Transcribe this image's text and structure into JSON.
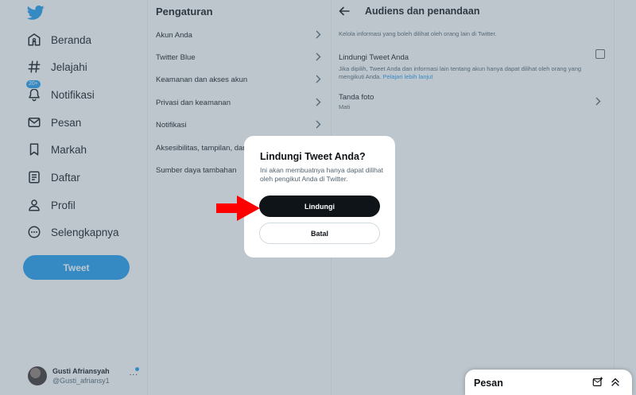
{
  "colors": {
    "accent": "#1d9bf0",
    "text": "#0f1419",
    "muted": "#536471",
    "annotation_arrow": "#ff0000"
  },
  "sidebar": {
    "logo_icon": "twitter-bird-icon",
    "items": [
      {
        "label": "Beranda",
        "icon": "home-icon"
      },
      {
        "label": "Jelajahi",
        "icon": "hashtag-icon"
      },
      {
        "label": "Notifikasi",
        "icon": "bell-icon",
        "badge": "20+"
      },
      {
        "label": "Pesan",
        "icon": "envelope-icon"
      },
      {
        "label": "Markah",
        "icon": "bookmark-icon"
      },
      {
        "label": "Daftar",
        "icon": "list-icon"
      },
      {
        "label": "Profil",
        "icon": "person-icon"
      },
      {
        "label": "Selengkapnya",
        "icon": "more-circle-icon"
      }
    ],
    "tweet_button": "Tweet",
    "account": {
      "name": "Gusti Afriansyah",
      "handle": "@Gusti_afriansy1",
      "more": "..."
    }
  },
  "settings": {
    "title": "Pengaturan",
    "items": [
      {
        "label": "Akun Anda",
        "chevron": true
      },
      {
        "label": "Twitter Blue",
        "chevron": true
      },
      {
        "label": "Keamanan dan akses akun",
        "chevron": true
      },
      {
        "label": "Privasi dan keamanan",
        "chevron": true
      },
      {
        "label": "Notifikasi",
        "chevron": true
      },
      {
        "label": "Aksesibilitas, tampilan, dan bahasa",
        "chevron": true
      },
      {
        "label": "Sumber daya tambahan",
        "chevron": false
      }
    ]
  },
  "detail": {
    "title": "Audiens dan penandaan",
    "description": "Kelola informasi yang boleh dilihat oleh orang lain di Twitter.",
    "protect_label": "Lindungi Tweet Anda",
    "protect_note": "Jika dipilih, Tweet Anda dan informasi lain tentang akun hanya dapat dilihat oleh orang yang mengikuti Anda.",
    "learn_more": "Pelajari lebih lanjut",
    "photo_label": "Tanda foto",
    "photo_value": "Mati"
  },
  "message_dock": {
    "title": "Pesan"
  },
  "modal": {
    "title": "Lindungi Tweet Anda?",
    "text": "Ini akan membuatnya hanya dapat dilihat oleh pengikut Anda di Twitter.",
    "confirm": "Lindungi",
    "cancel": "Batal"
  }
}
